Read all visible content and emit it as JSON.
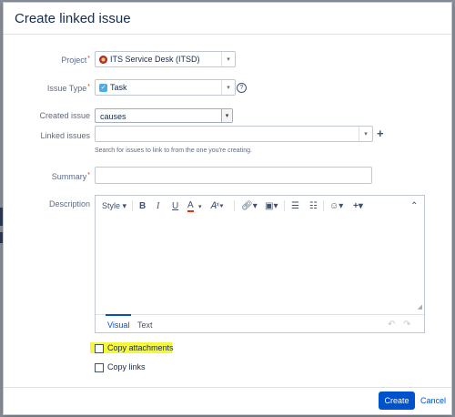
{
  "dialog": {
    "title": "Create linked issue"
  },
  "project": {
    "label": "Project",
    "value": "ITS Service Desk (ITSD)"
  },
  "issue_type": {
    "label": "Issue Type",
    "value": "Task"
  },
  "created_issue": {
    "label": "Created issue",
    "value": "causes"
  },
  "linked_issues": {
    "label": "Linked issues",
    "value": "",
    "hint": "Search for issues to link to from the one you're creating."
  },
  "summary": {
    "label": "Summary",
    "value": ""
  },
  "description": {
    "label": "Description",
    "toolbar": {
      "style": "Style",
      "bold": "B",
      "italic": "I",
      "underline": "U",
      "color": "A"
    },
    "tabs": {
      "visual": "Visual",
      "text": "Text"
    },
    "value": ""
  },
  "options": {
    "copy_attachments": "Copy attachments",
    "copy_links": "Copy links"
  },
  "footer": {
    "create": "Create",
    "cancel": "Cancel"
  },
  "colors": {
    "accent": "#0052cc",
    "highlight": "#f7f73a",
    "required": "#de350b"
  }
}
